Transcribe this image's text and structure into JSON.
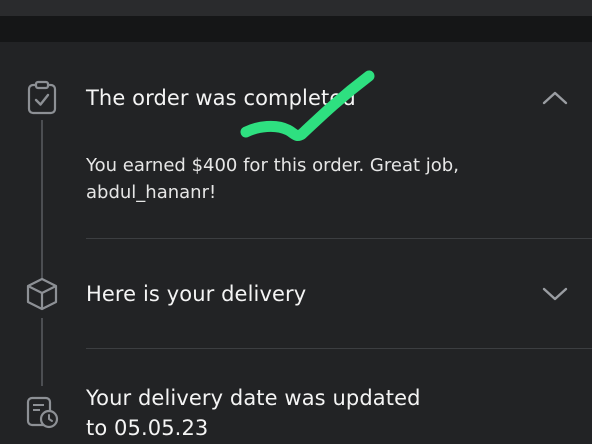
{
  "colors": {
    "background": "#222325",
    "text_primary": "#f4f4f4",
    "text_secondary": "#e6e6e6",
    "icon_gray": "#8d9095",
    "annotation_green": "#2ee080"
  },
  "timeline": [
    {
      "icon": "clipboard-check-icon",
      "title": "The order was completed",
      "body": "You earned $400 for this order. Great job, abdul_hananr!",
      "expanded": true,
      "toggle_icon": "chevron-up-icon"
    },
    {
      "icon": "package-box-icon",
      "title": "Here is your delivery",
      "expanded": false,
      "toggle_icon": "chevron-down-icon"
    },
    {
      "icon": "calendar-clock-icon",
      "title_line1": "Your delivery date was updated",
      "title_line2": "to 05.05.23"
    }
  ]
}
